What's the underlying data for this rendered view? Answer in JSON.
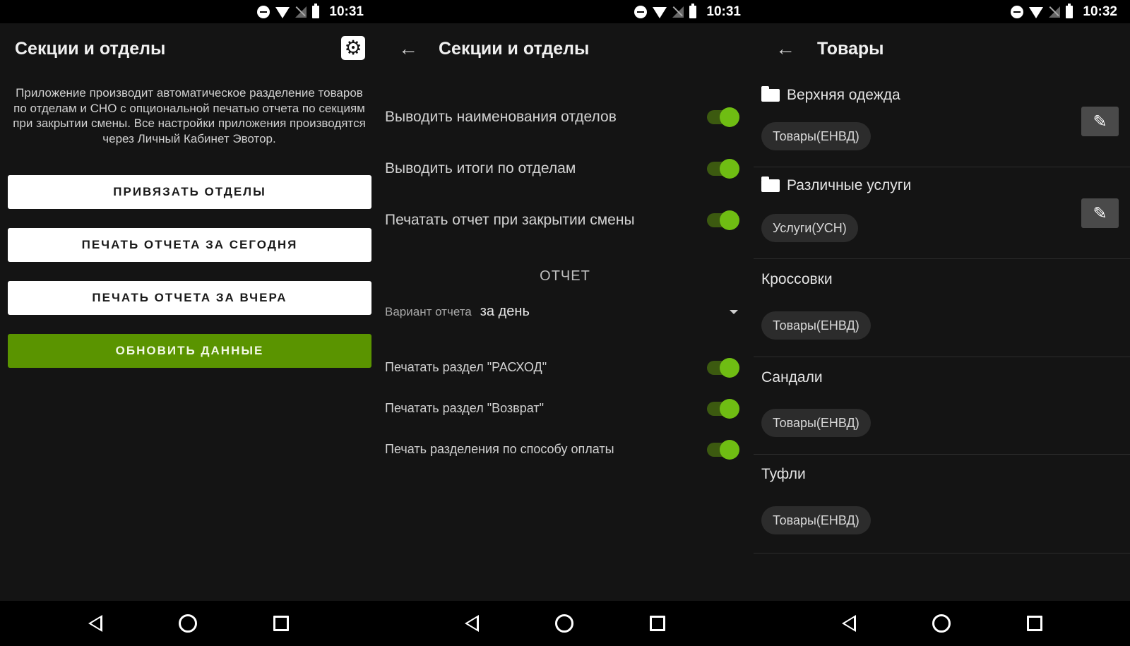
{
  "screens": [
    {
      "status": {
        "time": "10:31"
      },
      "title": "Секции и отделы",
      "description": "Приложение производит автоматическое разделение товаров по отделам и СНО с опциональной печатью отчета по секциям при закрытии смены. Все настройки приложения производятся через Личный Кабинет Эвотор.",
      "buttons": [
        {
          "label": "ПРИВЯЗАТЬ ОТДЕЛЫ"
        },
        {
          "label": "ПЕЧАТЬ ОТЧЕТА ЗА СЕГОДНЯ"
        },
        {
          "label": "ПЕЧАТЬ ОТЧЕТА ЗА ВЧЕРА"
        },
        {
          "label": "ОБНОВИТЬ ДАННЫЕ"
        }
      ]
    },
    {
      "status": {
        "time": "10:31"
      },
      "title": "Секции и отделы",
      "settings": [
        {
          "label": "Выводить наименования отделов",
          "enabled": true
        },
        {
          "label": "Выводить итоги по отделам",
          "enabled": true
        },
        {
          "label": "Печатать отчет при закрытии смены",
          "enabled": true
        }
      ],
      "report_section": "ОТЧЕТ",
      "report_variant": {
        "label": "Вариант отчета",
        "value": "за день"
      },
      "report_settings": [
        {
          "label": "Печатать раздел \"РАСХОД\"",
          "enabled": true
        },
        {
          "label": "Печатать раздел \"Возврат\"",
          "enabled": true
        },
        {
          "label": "Печать разделения по способу оплаты",
          "enabled": true
        }
      ]
    },
    {
      "status": {
        "time": "10:32"
      },
      "title": "Товары",
      "groups": [
        {
          "name": "Верхняя одежда",
          "chip": "Товары(ЕНВД)",
          "folder": true
        },
        {
          "name": "Различные услуги",
          "chip": "Услуги(УСН)",
          "folder": true
        },
        {
          "name": "Кроссовки",
          "chip": "Товары(ЕНВД)",
          "folder": false
        },
        {
          "name": "Сандали",
          "chip": "Товары(ЕНВД)",
          "folder": false
        },
        {
          "name": "Туфли",
          "chip": "Товары(ЕНВД)",
          "folder": false
        }
      ]
    }
  ],
  "colors": {
    "accent_green": "#5a9400",
    "toggle_on": "#6fbd13",
    "background": "#141414"
  },
  "icons": {
    "status": [
      "do-not-disturb-icon",
      "wifi-icon",
      "no-sim-icon",
      "battery-icon"
    ],
    "nav": [
      "back-triangle-icon",
      "home-circle-icon",
      "recent-square-icon"
    ],
    "settings": "gear-icon",
    "back": "arrow-left-icon",
    "folder": "folder-icon",
    "edit": "pencil-icon"
  }
}
